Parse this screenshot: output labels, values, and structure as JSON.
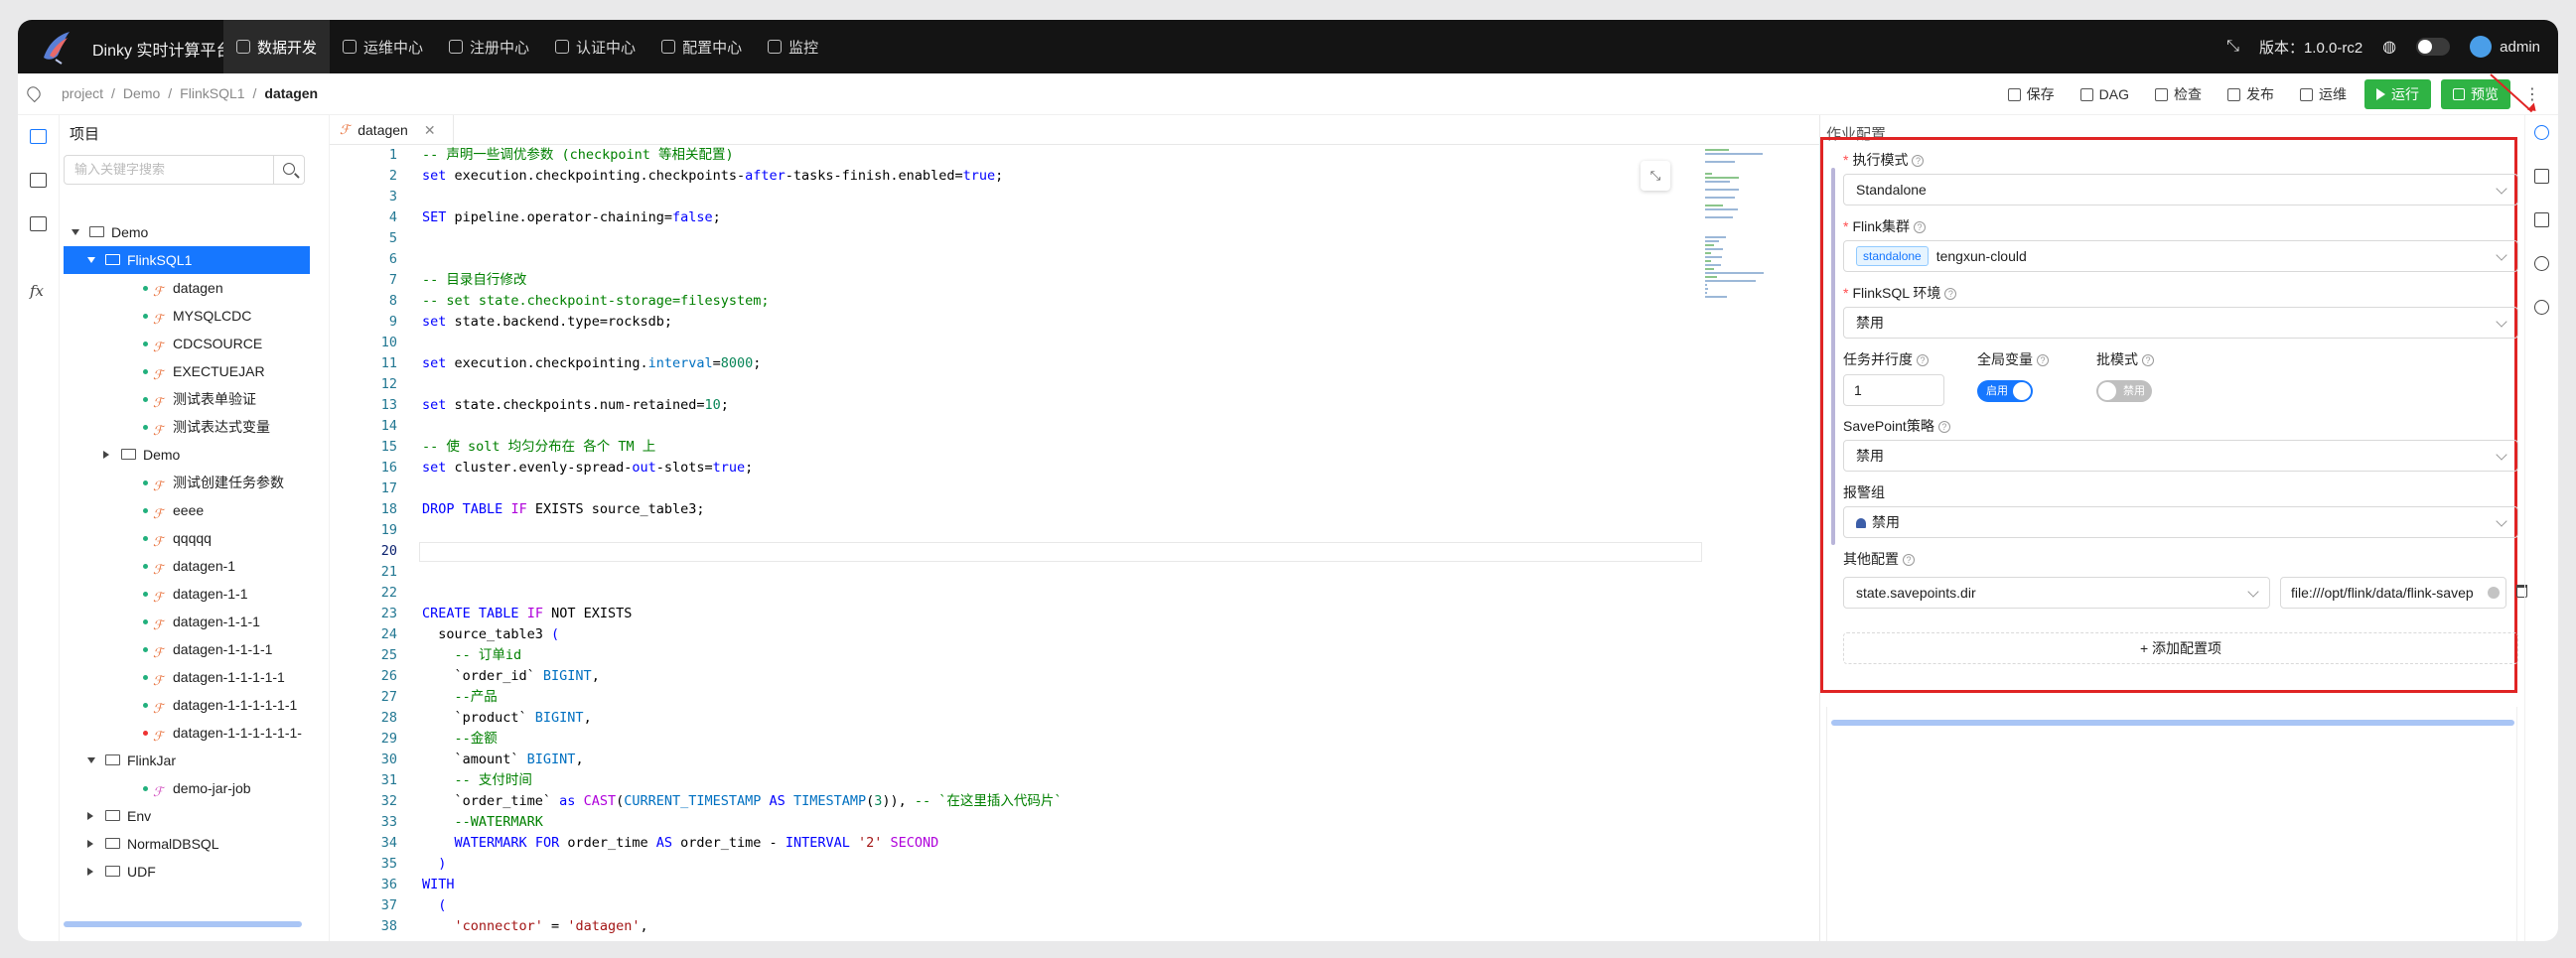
{
  "app": {
    "brand": "Dinky 实时计算平台",
    "version_label": "版本：1.0.0-rc2",
    "user": "admin"
  },
  "menu": [
    {
      "label": "数据开发",
      "icon": "terminal-icon",
      "active": true
    },
    {
      "label": "运维中心",
      "icon": "ops-grid-icon"
    },
    {
      "label": "注册中心",
      "icon": "registry-icon"
    },
    {
      "label": "认证中心",
      "icon": "shield-icon"
    },
    {
      "label": "配置中心",
      "icon": "gear-icon"
    },
    {
      "label": "监控",
      "icon": "dashboard-icon"
    }
  ],
  "breadcrumb": [
    "project",
    "Demo",
    "FlinkSQL1",
    "datagen"
  ],
  "toolbar": {
    "save": "保存",
    "dag": "DAG",
    "check": "检查",
    "publish": "发布",
    "ops": "运维",
    "run": "运行",
    "preview": "预览"
  },
  "project": {
    "title": "项目",
    "search_placeholder": "输入关键字搜索",
    "nodes": [
      {
        "label": "Demo",
        "type": "folder",
        "depth": 0,
        "caret": "open"
      },
      {
        "label": "FlinkSQL1",
        "type": "folder",
        "depth": 1,
        "caret": "open",
        "selected": true
      },
      {
        "label": "datagen",
        "type": "file",
        "depth": 2
      },
      {
        "label": "MYSQLCDC",
        "type": "file",
        "depth": 2
      },
      {
        "label": "CDCSOURCE",
        "type": "file",
        "depth": 2
      },
      {
        "label": "EXECTUEJAR",
        "type": "file",
        "depth": 2
      },
      {
        "label": "测试表单验证",
        "type": "file",
        "depth": 2
      },
      {
        "label": "测试表达式变量",
        "type": "file",
        "depth": 2
      },
      {
        "label": "Demo",
        "type": "folder",
        "depth": 2,
        "caret": "closed"
      },
      {
        "label": "测试创建任务参数",
        "type": "file",
        "depth": 2
      },
      {
        "label": "eeee",
        "type": "file",
        "depth": 2
      },
      {
        "label": "qqqqq",
        "type": "file",
        "depth": 2
      },
      {
        "label": "datagen-1",
        "type": "file",
        "depth": 2
      },
      {
        "label": "datagen-1-1",
        "type": "file",
        "depth": 2
      },
      {
        "label": "datagen-1-1-1",
        "type": "file",
        "depth": 2
      },
      {
        "label": "datagen-1-1-1-1",
        "type": "file",
        "depth": 2
      },
      {
        "label": "datagen-1-1-1-1-1",
        "type": "file",
        "depth": 2
      },
      {
        "label": "datagen-1-1-1-1-1-1",
        "type": "file",
        "depth": 2
      },
      {
        "label": "datagen-1-1-1-1-1-1-",
        "type": "file",
        "depth": 2,
        "status": "red"
      },
      {
        "label": "FlinkJar",
        "type": "folder",
        "depth": 1,
        "caret": "open"
      },
      {
        "label": "demo-jar-job",
        "type": "file",
        "depth": 2,
        "pink": true
      },
      {
        "label": "Env",
        "type": "folder",
        "depth": 1,
        "caret": "closed"
      },
      {
        "label": "NormalDBSQL",
        "type": "folder",
        "depth": 1,
        "caret": "closed"
      },
      {
        "label": "UDF",
        "type": "folder",
        "depth": 1,
        "caret": "closed"
      }
    ]
  },
  "editor": {
    "tab": "datagen",
    "current_line": 20,
    "lines": [
      {
        "n": 1,
        "t": "-- 声明一些调优参数 (checkpoint 等相关配置)",
        "c": "cm"
      },
      {
        "n": 2,
        "h": "<span class='kw'>set</span> execution.checkpointing.checkpoints-<span class='kw'>after</span>-tasks-finish.enabled=<span class='kw'>true</span>;"
      },
      {
        "n": 3,
        "t": ""
      },
      {
        "n": 4,
        "h": "<span class='kw'>SET</span> pipeline.operator-chaining=<span class='kw'>false</span>;"
      },
      {
        "n": 5,
        "t": ""
      },
      {
        "n": 6,
        "t": ""
      },
      {
        "n": 7,
        "t": "-- 目录自行修改",
        "c": "cm"
      },
      {
        "n": 8,
        "t": "-- set state.checkpoint-storage=filesystem;",
        "c": "cm"
      },
      {
        "n": 9,
        "h": "<span class='kw'>set</span> state.backend.type=rocksdb;"
      },
      {
        "n": 10,
        "t": ""
      },
      {
        "n": 11,
        "h": "<span class='kw'>set</span> execution.checkpointing.<span class='bl'>interval</span>=<span class='nm'>8000</span>;"
      },
      {
        "n": 12,
        "t": ""
      },
      {
        "n": 13,
        "h": "<span class='kw'>set</span> state.checkpoints.num-retained=<span class='nm'>10</span>;"
      },
      {
        "n": 14,
        "t": ""
      },
      {
        "n": 15,
        "t": "-- 使 solt 均匀分布在 各个 TM 上",
        "c": "cm"
      },
      {
        "n": 16,
        "h": "<span class='kw'>set</span> cluster.evenly-spread-<span class='kw'>out</span>-slots=<span class='kw'>true</span>;"
      },
      {
        "n": 17,
        "t": ""
      },
      {
        "n": 18,
        "h": "<span class='kw'>DROP</span> <span class='kw'>TABLE</span> <span class='pk'>IF</span> EXISTS source_table3;"
      },
      {
        "n": 19,
        "t": ""
      },
      {
        "n": 20,
        "t": ""
      },
      {
        "n": 21,
        "t": ""
      },
      {
        "n": 22,
        "t": ""
      },
      {
        "n": 23,
        "h": "<span class='kw'>CREATE</span> <span class='kw'>TABLE</span> <span class='pk'>IF</span> NOT EXISTS"
      },
      {
        "n": 24,
        "h": "  source_table3 <span class='kw'>(</span>"
      },
      {
        "n": 25,
        "t": "    -- 订单id",
        "c": "cm"
      },
      {
        "n": 26,
        "h": "    `order_id` <span class='bl'>BIGINT</span>,"
      },
      {
        "n": 27,
        "t": "    --产品",
        "c": "cm"
      },
      {
        "n": 28,
        "h": "    `product` <span class='bl'>BIGINT</span>,"
      },
      {
        "n": 29,
        "t": "    --金额",
        "c": "cm"
      },
      {
        "n": 30,
        "h": "    `amount` <span class='bl'>BIGINT</span>,"
      },
      {
        "n": 31,
        "t": "    -- 支付时间",
        "c": "cm"
      },
      {
        "n": 32,
        "h": "    `order_time` <span class='kw'>as</span> <span class='pk'>CAST</span>(<span class='bl'>CURRENT_TIMESTAMP</span> <span class='kw'>AS</span> <span class='bl'>TIMESTAMP</span>(<span class='nm'>3</span>)), <span class='cm'>-- `在这里插入代码片`</span>"
      },
      {
        "n": 33,
        "t": "    --WATERMARK",
        "c": "cm"
      },
      {
        "n": 34,
        "h": "    <span class='kw'>WATERMARK</span> <span class='kw'>FOR</span> order_time <span class='kw'>AS</span> order_time - <span class='kw'>INTERVAL</span> <span class='str'>'2'</span> <span class='pk'>SECOND</span>"
      },
      {
        "n": 35,
        "h": "  <span class='kw'>)</span>"
      },
      {
        "n": 36,
        "h": "<span class='kw'>WITH</span>"
      },
      {
        "n": 37,
        "h": "  <span class='kw'>(</span>"
      },
      {
        "n": 38,
        "h": "    <span class='str'>'connector'</span> = <span class='str'>'datagen'</span>,"
      }
    ]
  },
  "config": {
    "title": "作业配置",
    "exec_mode_label": "执行模式",
    "exec_mode_value": "Standalone",
    "flink_cluster_label": "Flink集群",
    "flink_cluster_tag": "standalone",
    "flink_cluster_value": "tengxun-clould",
    "flinksql_env_label": "FlinkSQL 环境",
    "flinksql_env_value": "禁用",
    "parallelism_label": "任务并行度",
    "parallelism_value": "1",
    "global_var_label": "全局变量",
    "global_var_switch": "启用",
    "batch_label": "批模式",
    "batch_switch": "禁用",
    "savepoint_label": "SavePoint策略",
    "savepoint_value": "禁用",
    "alarm_label": "报警组",
    "alarm_value": "禁用",
    "other_label": "其他配置",
    "other_key": "state.savepoints.dir",
    "other_value": "file:///opt/flink/data/flink-savep",
    "add_label": "+ 添加配置项"
  }
}
